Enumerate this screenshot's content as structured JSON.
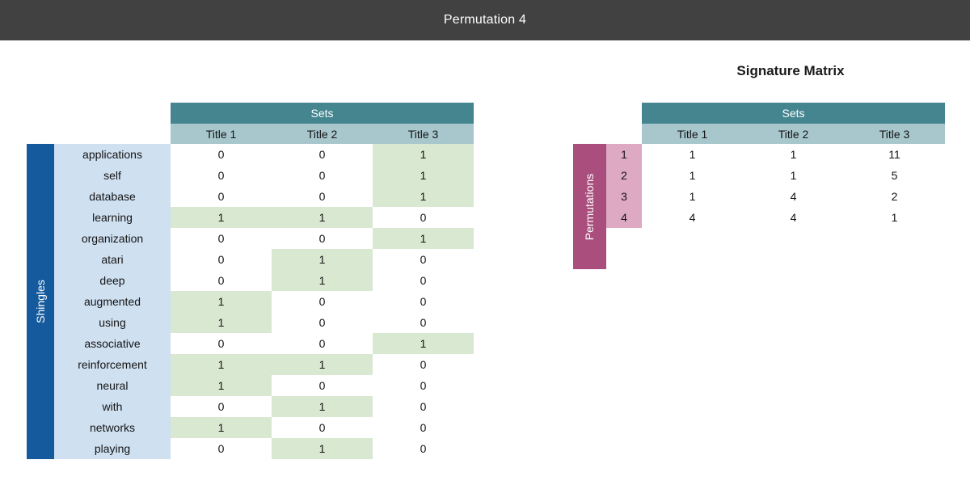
{
  "window": {
    "title": "Permutation 4",
    "title_bar_color": "#414141"
  },
  "colors": {
    "header_group": "#44858f",
    "header_columns": "#a7c7cc",
    "shingles_bar": "#155a9c",
    "shingles_column": "#cfe0f1",
    "permutations_bar": "#a94e7d",
    "permutations_column": "#dda9c3",
    "highlight": "#d9e8d0",
    "cell_background": "#ffffff"
  },
  "characteristic_matrix": {
    "side_label": "Shingles",
    "group_header": "Sets",
    "columns": [
      "Title 1",
      "Title 2",
      "Title 3"
    ],
    "rows": [
      {
        "shingle": "applications",
        "values": [
          0,
          0,
          1
        ]
      },
      {
        "shingle": "self",
        "values": [
          0,
          0,
          1
        ]
      },
      {
        "shingle": "database",
        "values": [
          0,
          0,
          1
        ]
      },
      {
        "shingle": "learning",
        "values": [
          1,
          1,
          0
        ]
      },
      {
        "shingle": "organization",
        "values": [
          0,
          0,
          1
        ]
      },
      {
        "shingle": "atari",
        "values": [
          0,
          1,
          0
        ]
      },
      {
        "shingle": "deep",
        "values": [
          0,
          1,
          0
        ]
      },
      {
        "shingle": "augmented",
        "values": [
          1,
          0,
          0
        ]
      },
      {
        "shingle": "using",
        "values": [
          1,
          0,
          0
        ]
      },
      {
        "shingle": "associative",
        "values": [
          0,
          0,
          1
        ]
      },
      {
        "shingle": "reinforcement",
        "values": [
          1,
          1,
          0
        ]
      },
      {
        "shingle": "neural",
        "values": [
          1,
          0,
          0
        ]
      },
      {
        "shingle": "with",
        "values": [
          0,
          1,
          0
        ]
      },
      {
        "shingle": "networks",
        "values": [
          1,
          0,
          0
        ]
      },
      {
        "shingle": "playing",
        "values": [
          0,
          1,
          0
        ]
      }
    ]
  },
  "signature_matrix": {
    "title": "Signature Matrix",
    "side_label": "Permutations",
    "group_header": "Sets",
    "columns": [
      "Title 1",
      "Title 2",
      "Title 3"
    ],
    "rows": [
      {
        "permutation": "1",
        "values": [
          "1",
          "1",
          "11"
        ]
      },
      {
        "permutation": "2",
        "values": [
          "1",
          "1",
          "5"
        ]
      },
      {
        "permutation": "3",
        "values": [
          "1",
          "4",
          "2"
        ]
      },
      {
        "permutation": "4",
        "values": [
          "4",
          "4",
          "1"
        ]
      }
    ]
  }
}
